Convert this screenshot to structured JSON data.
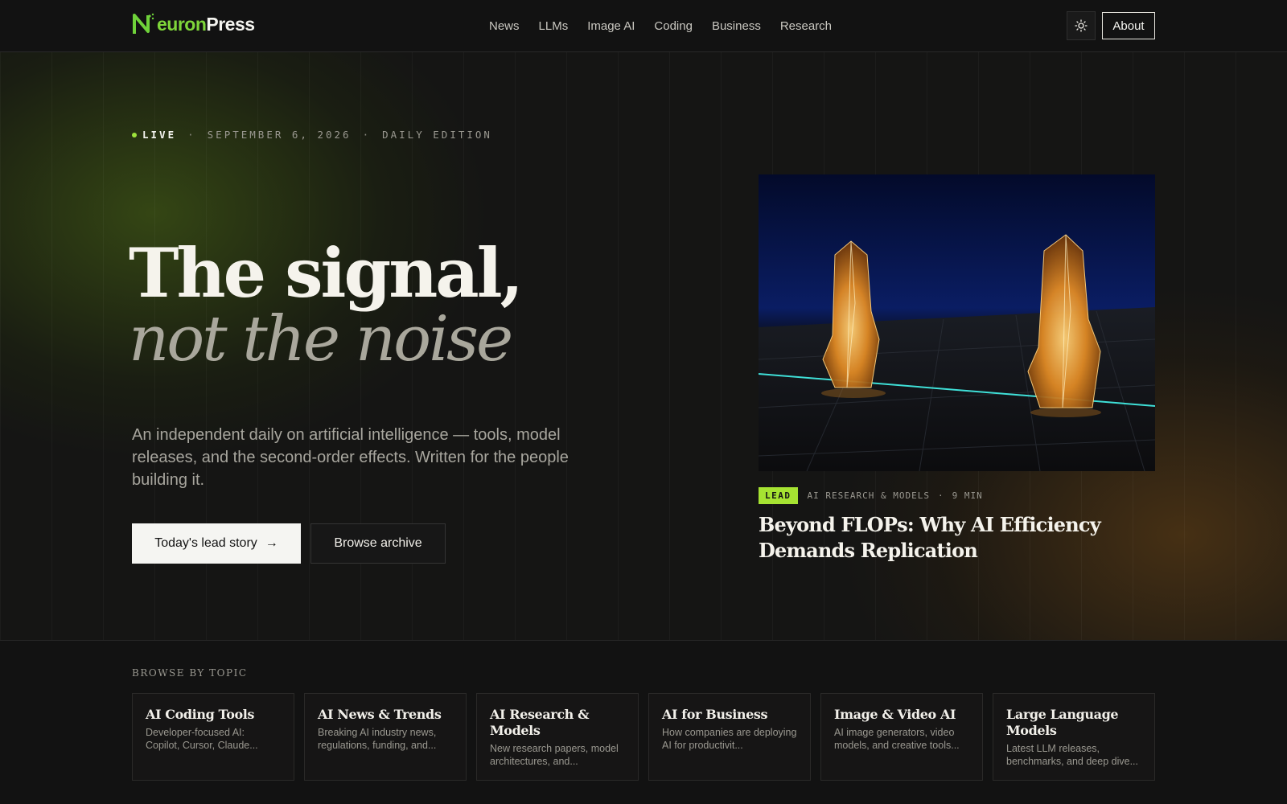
{
  "header": {
    "logo_text_accent": "N",
    "logo_text_green": "euron",
    "logo_text_white": "Press",
    "nav": [
      "News",
      "LLMs",
      "Image AI",
      "Coding",
      "Business",
      "Research"
    ],
    "theme_icon": "sun-icon",
    "about_label": "About"
  },
  "hero": {
    "live_label": "LIVE",
    "date": "SEPTEMBER 6, 2026",
    "edition": "DAILY EDITION",
    "separator": "·",
    "headline_line1": "The signal,",
    "headline_line2": "not the noise",
    "subhead": "An independent daily on artificial intelligence — tools, model releases, and the second-order effects. Written for the people building it.",
    "primary_cta": "Today's lead story",
    "primary_cta_arrow": "→",
    "secondary_cta": "Browse archive"
  },
  "lead": {
    "badge": "LEAD",
    "category": "AI RESEARCH & MODELS",
    "read_time": "9 MIN",
    "separator": "·",
    "title": "Beyond FLOPs: Why AI Efficiency Demands Replication"
  },
  "topics": {
    "label": "BROWSE BY TOPIC",
    "items": [
      {
        "title": "AI Coding Tools",
        "desc": "Developer-focused AI: Copilot, Cursor, Claude..."
      },
      {
        "title": "AI News & Trends",
        "desc": "Breaking AI industry news, regulations, funding, and..."
      },
      {
        "title": "AI Research & Models",
        "desc": "New research papers, model architectures, and..."
      },
      {
        "title": "AI for Business",
        "desc": "How companies are deploying AI for productivit..."
      },
      {
        "title": "Image & Video AI",
        "desc": "AI image generators, video models, and creative tools..."
      },
      {
        "title": "Large Language Models",
        "desc": "Latest LLM releases, benchmarks, and deep dive..."
      }
    ]
  },
  "colors": {
    "accent_green": "#a6e332",
    "background": "#121212",
    "text_primary": "#f5f3ec",
    "text_muted": "#9a9890"
  }
}
